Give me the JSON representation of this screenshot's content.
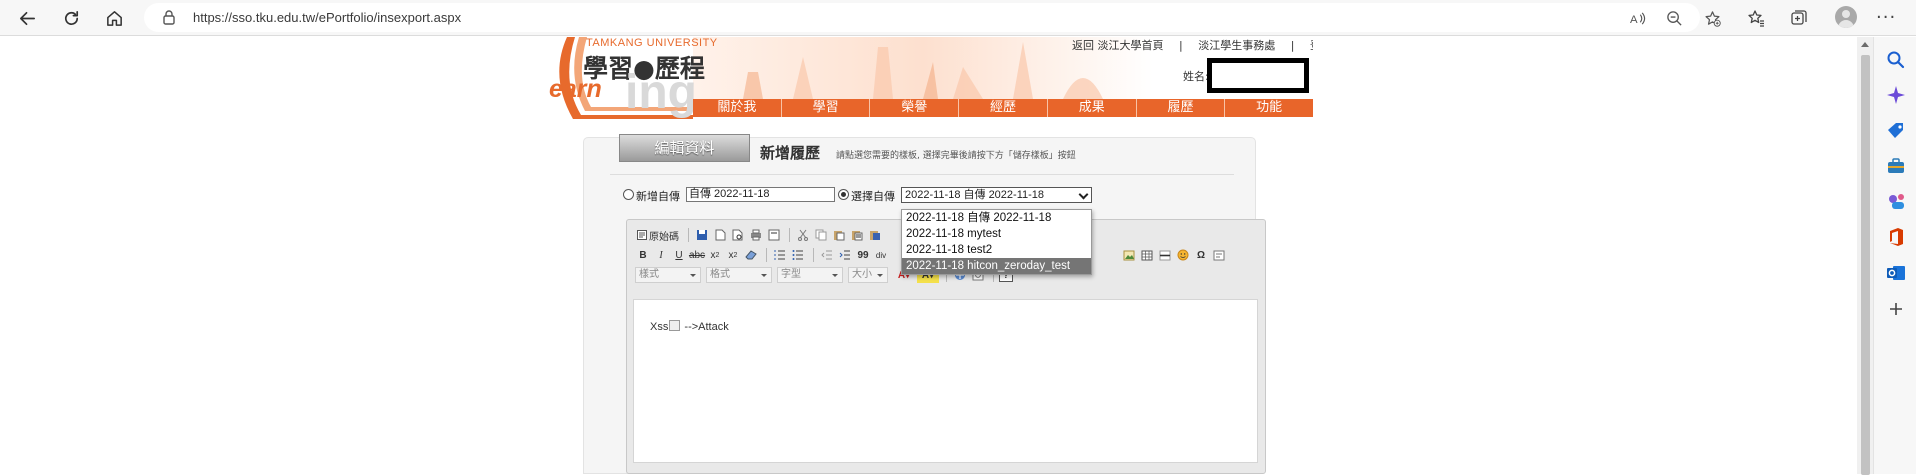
{
  "browser": {
    "url": "https://sso.tku.edu.tw/ePortfolio/insexport.aspx"
  },
  "header": {
    "logo_university": "TAMKANG UNIVERSITY",
    "logo_title": "學習●歷程",
    "logo_learn": "earn",
    "logo_ing": "ing",
    "top_links": [
      "返回 淡江大學首頁",
      "|",
      "淡江學生事務處",
      "|",
      "登出"
    ],
    "name_label": "姓名:"
  },
  "nav": {
    "items": [
      "關於我",
      "學習",
      "榮譽",
      "經歷",
      "成果",
      "履歷",
      "功能"
    ]
  },
  "main": {
    "edit_tab": "編輯資料",
    "section_title": "新增履歷",
    "section_hint": "請點選您需要的樣板, 選擇完畢後請按下方「儲存樣板」按鈕",
    "new_radio_label": "新增自傳",
    "new_input_value": "自傳 2022-11-18",
    "select_radio_label": "選擇自傳",
    "select_value": "2022-11-18 自傳 2022-11-18",
    "dropdown_options": [
      "2022-11-18 自傳 2022-11-18",
      "2022-11-18 mytest",
      "2022-11-18 test2",
      "2022-11-18 hitcon_zeroday_test"
    ]
  },
  "editor": {
    "source_label": "原始碼",
    "style_combo": "樣式",
    "format_combo": "格式",
    "font_combo": "字型",
    "size_combo": "大小",
    "content_before": "Xss",
    "content_after": "-->Attack"
  },
  "colors": {
    "nav_orange": "#e8652a",
    "logo_orange": "#e76a2c",
    "dropdown_selected": "#757575"
  }
}
